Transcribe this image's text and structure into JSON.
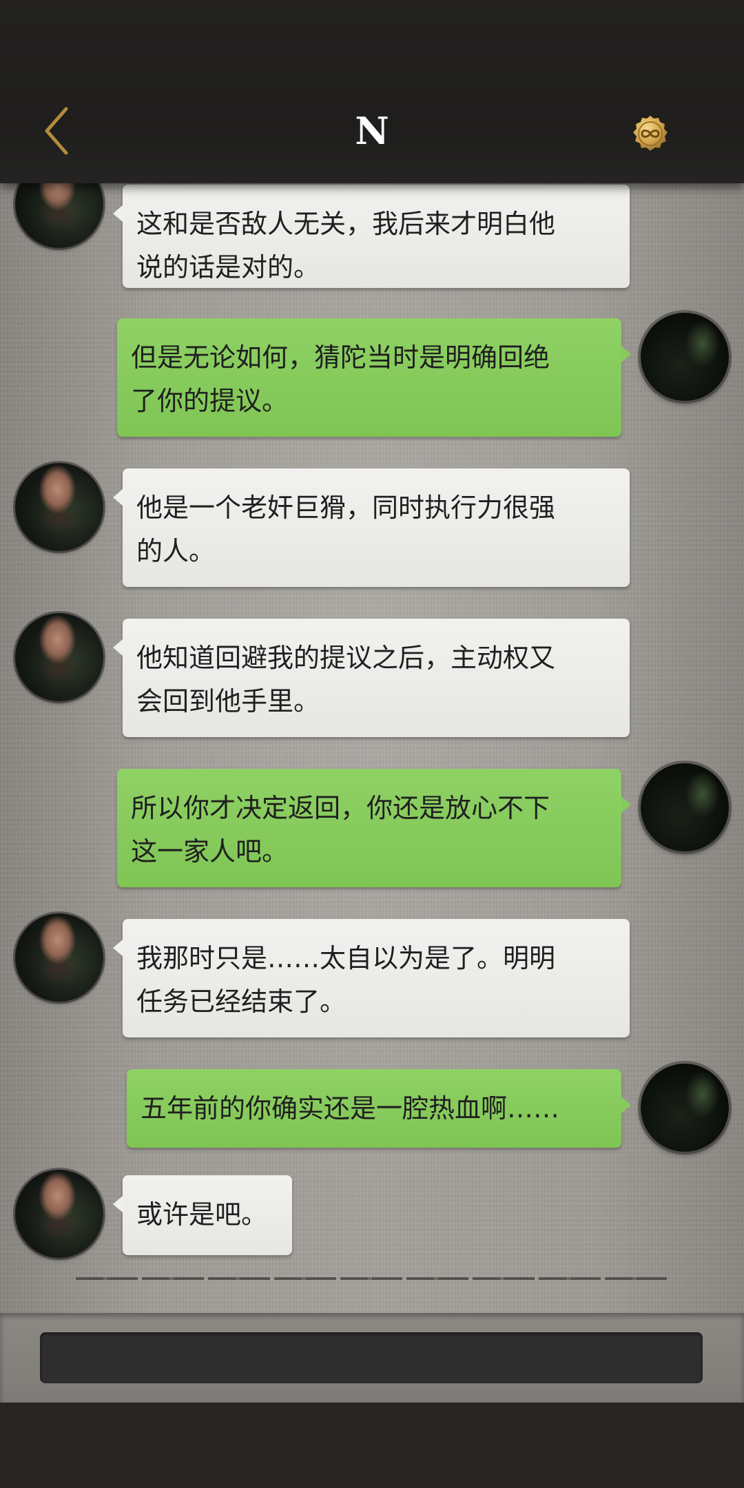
{
  "header": {
    "title": "N",
    "back_icon": "chevron-left-icon",
    "badge_icon": "infinity-coin-icon",
    "accent_color": "#c79a45"
  },
  "messages": [
    {
      "sender": "other",
      "text": "这和是否敌人无关，我后来才明白他\n说的话是对的。"
    },
    {
      "sender": "self",
      "text": "但是无论如何，猜陀当时是明确回绝\n了你的提议。"
    },
    {
      "sender": "other",
      "text": "他是一个老奸巨猾，同时执行力很强\n的人。"
    },
    {
      "sender": "other",
      "text": "他知道回避我的提议之后，主动权又\n会回到他手里。"
    },
    {
      "sender": "self",
      "text": "所以你才决定返回，你还是放心不下\n这一家人吧。"
    },
    {
      "sender": "other",
      "text": "我那时只是……太自以为是了。明明\n任务已经结束了。"
    },
    {
      "sender": "self",
      "text": "五年前的你确实还是一腔热血啊……"
    },
    {
      "sender": "other",
      "text": "或许是吧。"
    }
  ],
  "colors": {
    "bubble_other": "#ededeb",
    "bubble_self": "#86cb5b",
    "header_bg": "#212020"
  },
  "input": {
    "placeholder": ""
  }
}
